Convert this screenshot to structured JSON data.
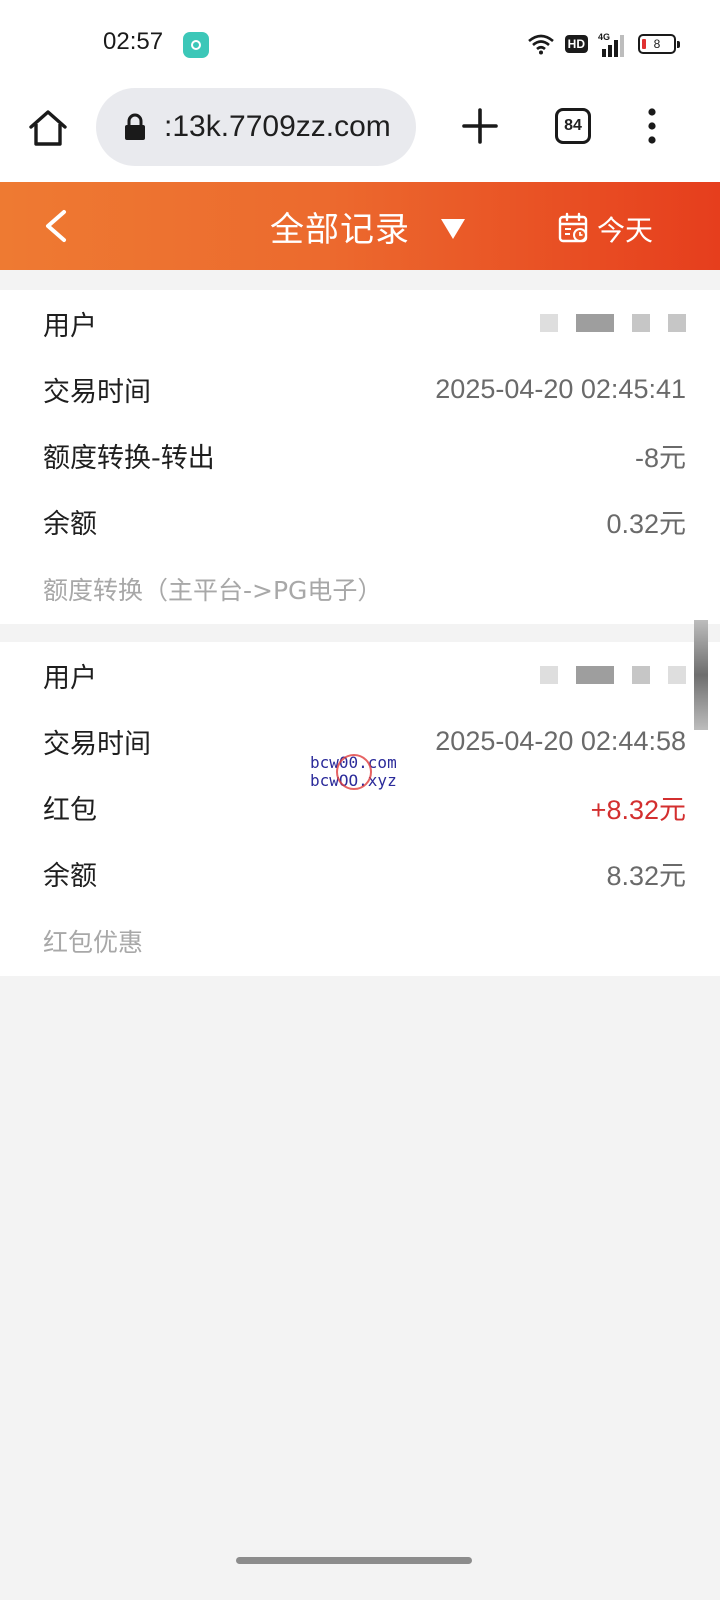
{
  "status_bar": {
    "time": "02:57",
    "network": "4G",
    "hd_label": "HD",
    "battery": "8",
    "icons": [
      "app-icon",
      "wifi-icon",
      "hd-icon",
      "cellular-signal-icon",
      "battery-icon"
    ]
  },
  "browser": {
    "url": ":13k.7709zz.com",
    "tab_count": "84",
    "icons": [
      "home-icon",
      "lock-icon",
      "plus-icon",
      "tabs-icon",
      "more-vert-icon"
    ]
  },
  "header": {
    "title": "全部记录",
    "date_filter": "今天",
    "gradient_colors": [
      "#ee7a32",
      "#e63e1d"
    ],
    "icons": [
      "back-chevron-icon",
      "dropdown-triangle-icon",
      "calendar-icon"
    ]
  },
  "records": [
    {
      "user_label": "用户",
      "time_label": "交易时间",
      "time_value": "2025-04-20 02:45:41",
      "type_label": "额度转换-转出",
      "amount": "-8元",
      "balance_label": "余额",
      "balance_value": "0.32元",
      "description": "额度转换（主平台->PG电子）"
    },
    {
      "user_label": "用户",
      "time_label": "交易时间",
      "time_value": "2025-04-20 02:44:58",
      "type_label": "红包",
      "amount": "+8.32元",
      "balance_label": "余额",
      "balance_value": "8.32元",
      "description": "红包优惠"
    }
  ],
  "watermark": {
    "line1": "bcw00.com",
    "line2": "bcwOO.xyz"
  },
  "colors": {
    "positive_amount": "#d32f2f",
    "page_background": "#f3f3f3"
  }
}
